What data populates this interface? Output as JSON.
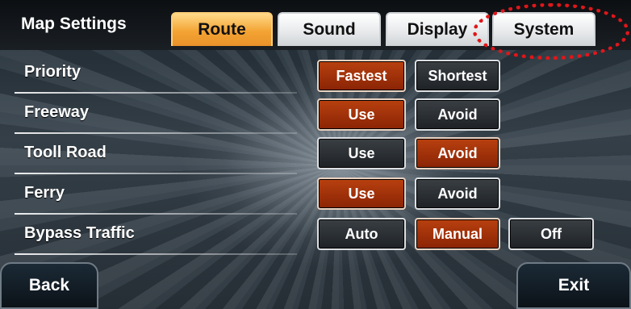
{
  "header": {
    "title": "Map Settings"
  },
  "tabs": [
    "Route",
    "Sound",
    "Display",
    "System"
  ],
  "rows": [
    {
      "label": "Priority",
      "options": [
        "Fastest",
        "Shortest"
      ],
      "selected": "Fastest"
    },
    {
      "label": "Freeway",
      "options": [
        "Use",
        "Avoid"
      ],
      "selected": "Use"
    },
    {
      "label": "Tooll Road",
      "options": [
        "Use",
        "Avoid"
      ],
      "selected": "Avoid"
    },
    {
      "label": "Ferry",
      "options": [
        "Use",
        "Avoid"
      ],
      "selected": "Use"
    },
    {
      "label": "Bypass Traffic",
      "options": [
        "Auto",
        "Manual",
        "Off"
      ],
      "selected": "Manual"
    }
  ],
  "footer": {
    "back_label": "Back",
    "exit_label": "Exit"
  },
  "colors": {
    "active_tab": "#f3a433",
    "selected_option": "#a8360c",
    "annotation": "#e0161a"
  }
}
